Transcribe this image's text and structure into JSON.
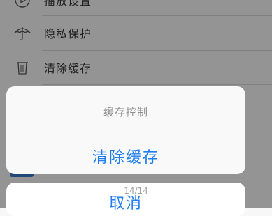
{
  "settings": {
    "items": [
      {
        "label": "播放设置",
        "icon": "play-circle-icon"
      },
      {
        "label": "隐私保护",
        "icon": "umbrella-icon"
      },
      {
        "label": "清除缓存",
        "icon": "trash-icon"
      }
    ]
  },
  "action_sheet": {
    "title": "缓存控制",
    "clear_button": "清除缓存",
    "cancel_button": "取消"
  },
  "page_indicator": "14/14",
  "colors": {
    "accent": "#1e7ef0",
    "overlay": "rgba(0,0,0,0.40)"
  }
}
